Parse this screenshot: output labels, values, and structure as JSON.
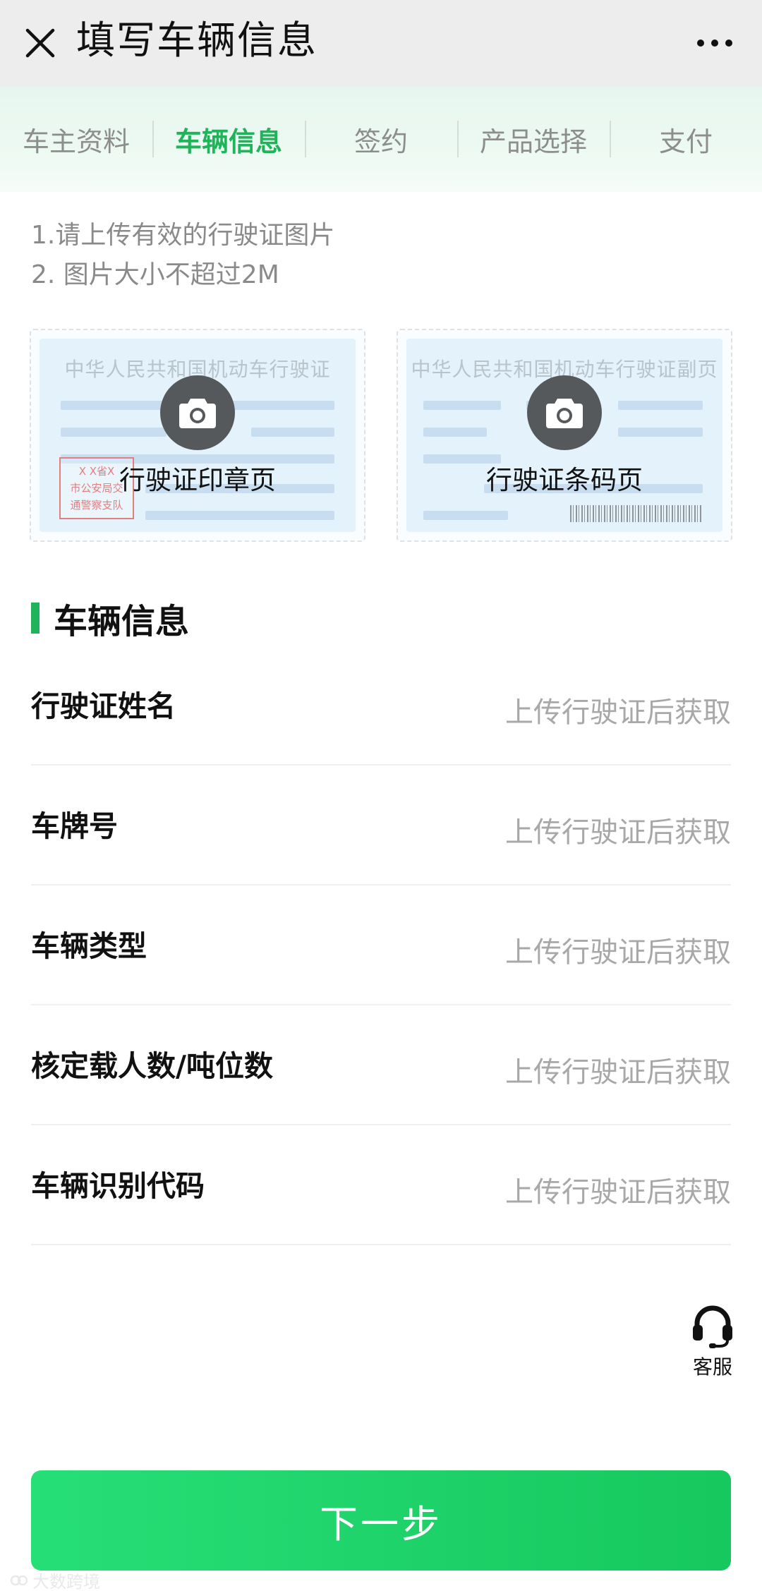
{
  "appbar": {
    "title": "填写车辆信息",
    "close_icon": "close-icon",
    "more_icon": "more-icon"
  },
  "steps": [
    {
      "label": "车主资料",
      "active": false
    },
    {
      "label": "车辆信息",
      "active": true
    },
    {
      "label": "签约",
      "active": false
    },
    {
      "label": "产品选择",
      "active": false
    },
    {
      "label": "支付",
      "active": false
    }
  ],
  "tips": {
    "line1": "1.请上传有效的行驶证图片",
    "line2": "2. 图片大小不超过2M"
  },
  "uploads": {
    "front": {
      "doc_title": "中华人民共和国机动车行驶证",
      "label": "行驶证印章页",
      "stamp_line1": "X  X省X",
      "stamp_line2": "市公安局交",
      "stamp_line3": "通警察支队",
      "icon": "camera-icon"
    },
    "back": {
      "doc_title": "中华人民共和国机动车行驶证副页",
      "label": "行驶证条码页",
      "icon": "camera-icon"
    }
  },
  "section": {
    "title": "车辆信息"
  },
  "rows": [
    {
      "label": "行驶证姓名",
      "value": "上传行驶证后获取"
    },
    {
      "label": "车牌号",
      "value": "上传行驶证后获取"
    },
    {
      "label": "车辆类型",
      "value": "上传行驶证后获取"
    },
    {
      "label": "核定载人数/吨位数",
      "value": "上传行驶证后获取"
    },
    {
      "label": "车辆识别代码",
      "value": "上传行驶证后获取"
    }
  ],
  "service": {
    "label": "客服",
    "icon": "headset-icon"
  },
  "next_button": {
    "label": "下一步"
  },
  "watermark": {
    "text": "大数跨境"
  },
  "colors": {
    "accent": "#1fb45a",
    "button_gradient_start": "#27df77",
    "button_gradient_end": "#16c85e",
    "placeholder": "#a8a8a8"
  }
}
